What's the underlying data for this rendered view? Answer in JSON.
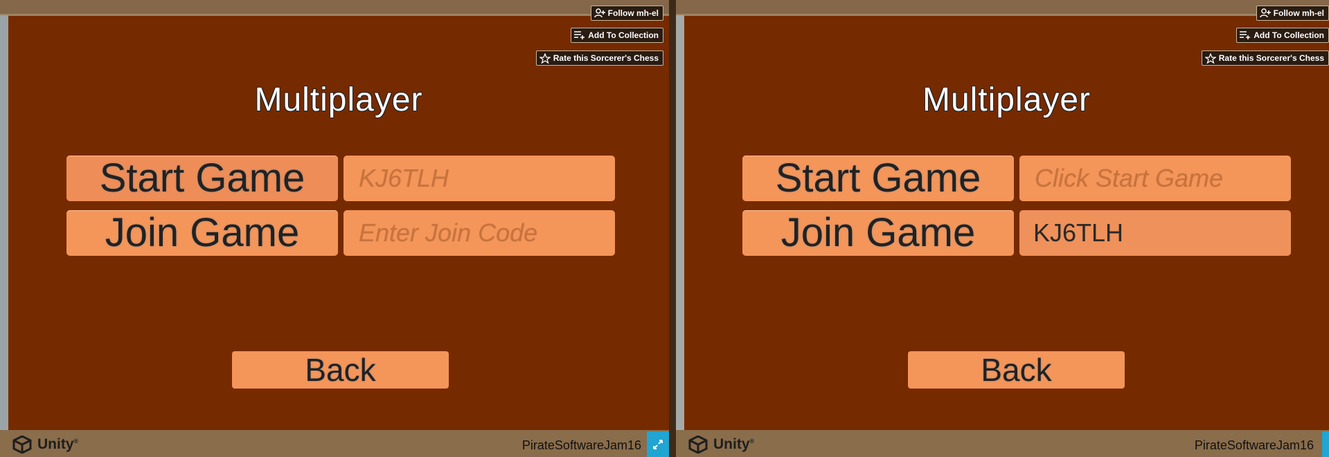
{
  "overlay": {
    "follow_label": "Follow mh-el",
    "collection_label": "Add To Collection",
    "rate_label": "Rate this Sorcerer's Chess"
  },
  "left_view": {
    "title": "Multiplayer",
    "start_button": "Start Game",
    "join_button": "Join Game",
    "start_code_field": "KJ6TLH",
    "join_code_field": "Enter Join Code",
    "back_button": "Back"
  },
  "right_view": {
    "title": "Multiplayer",
    "start_button": "Start Game",
    "join_button": "Join Game",
    "start_code_field": "Click Start Game",
    "join_code_field": "KJ6TLH",
    "back_button": "Back"
  },
  "footer": {
    "engine_label": "Unity",
    "game_label": "PirateSoftwareJam16"
  },
  "colors": {
    "game_background": "#762a00",
    "button": "#f4955a",
    "frame": "#8a6d4b",
    "fullscreen": "#21a5d3"
  },
  "icons": [
    "user-plus-icon",
    "playlist-add-icon",
    "star-icon",
    "unity-icon",
    "fullscreen-icon"
  ]
}
